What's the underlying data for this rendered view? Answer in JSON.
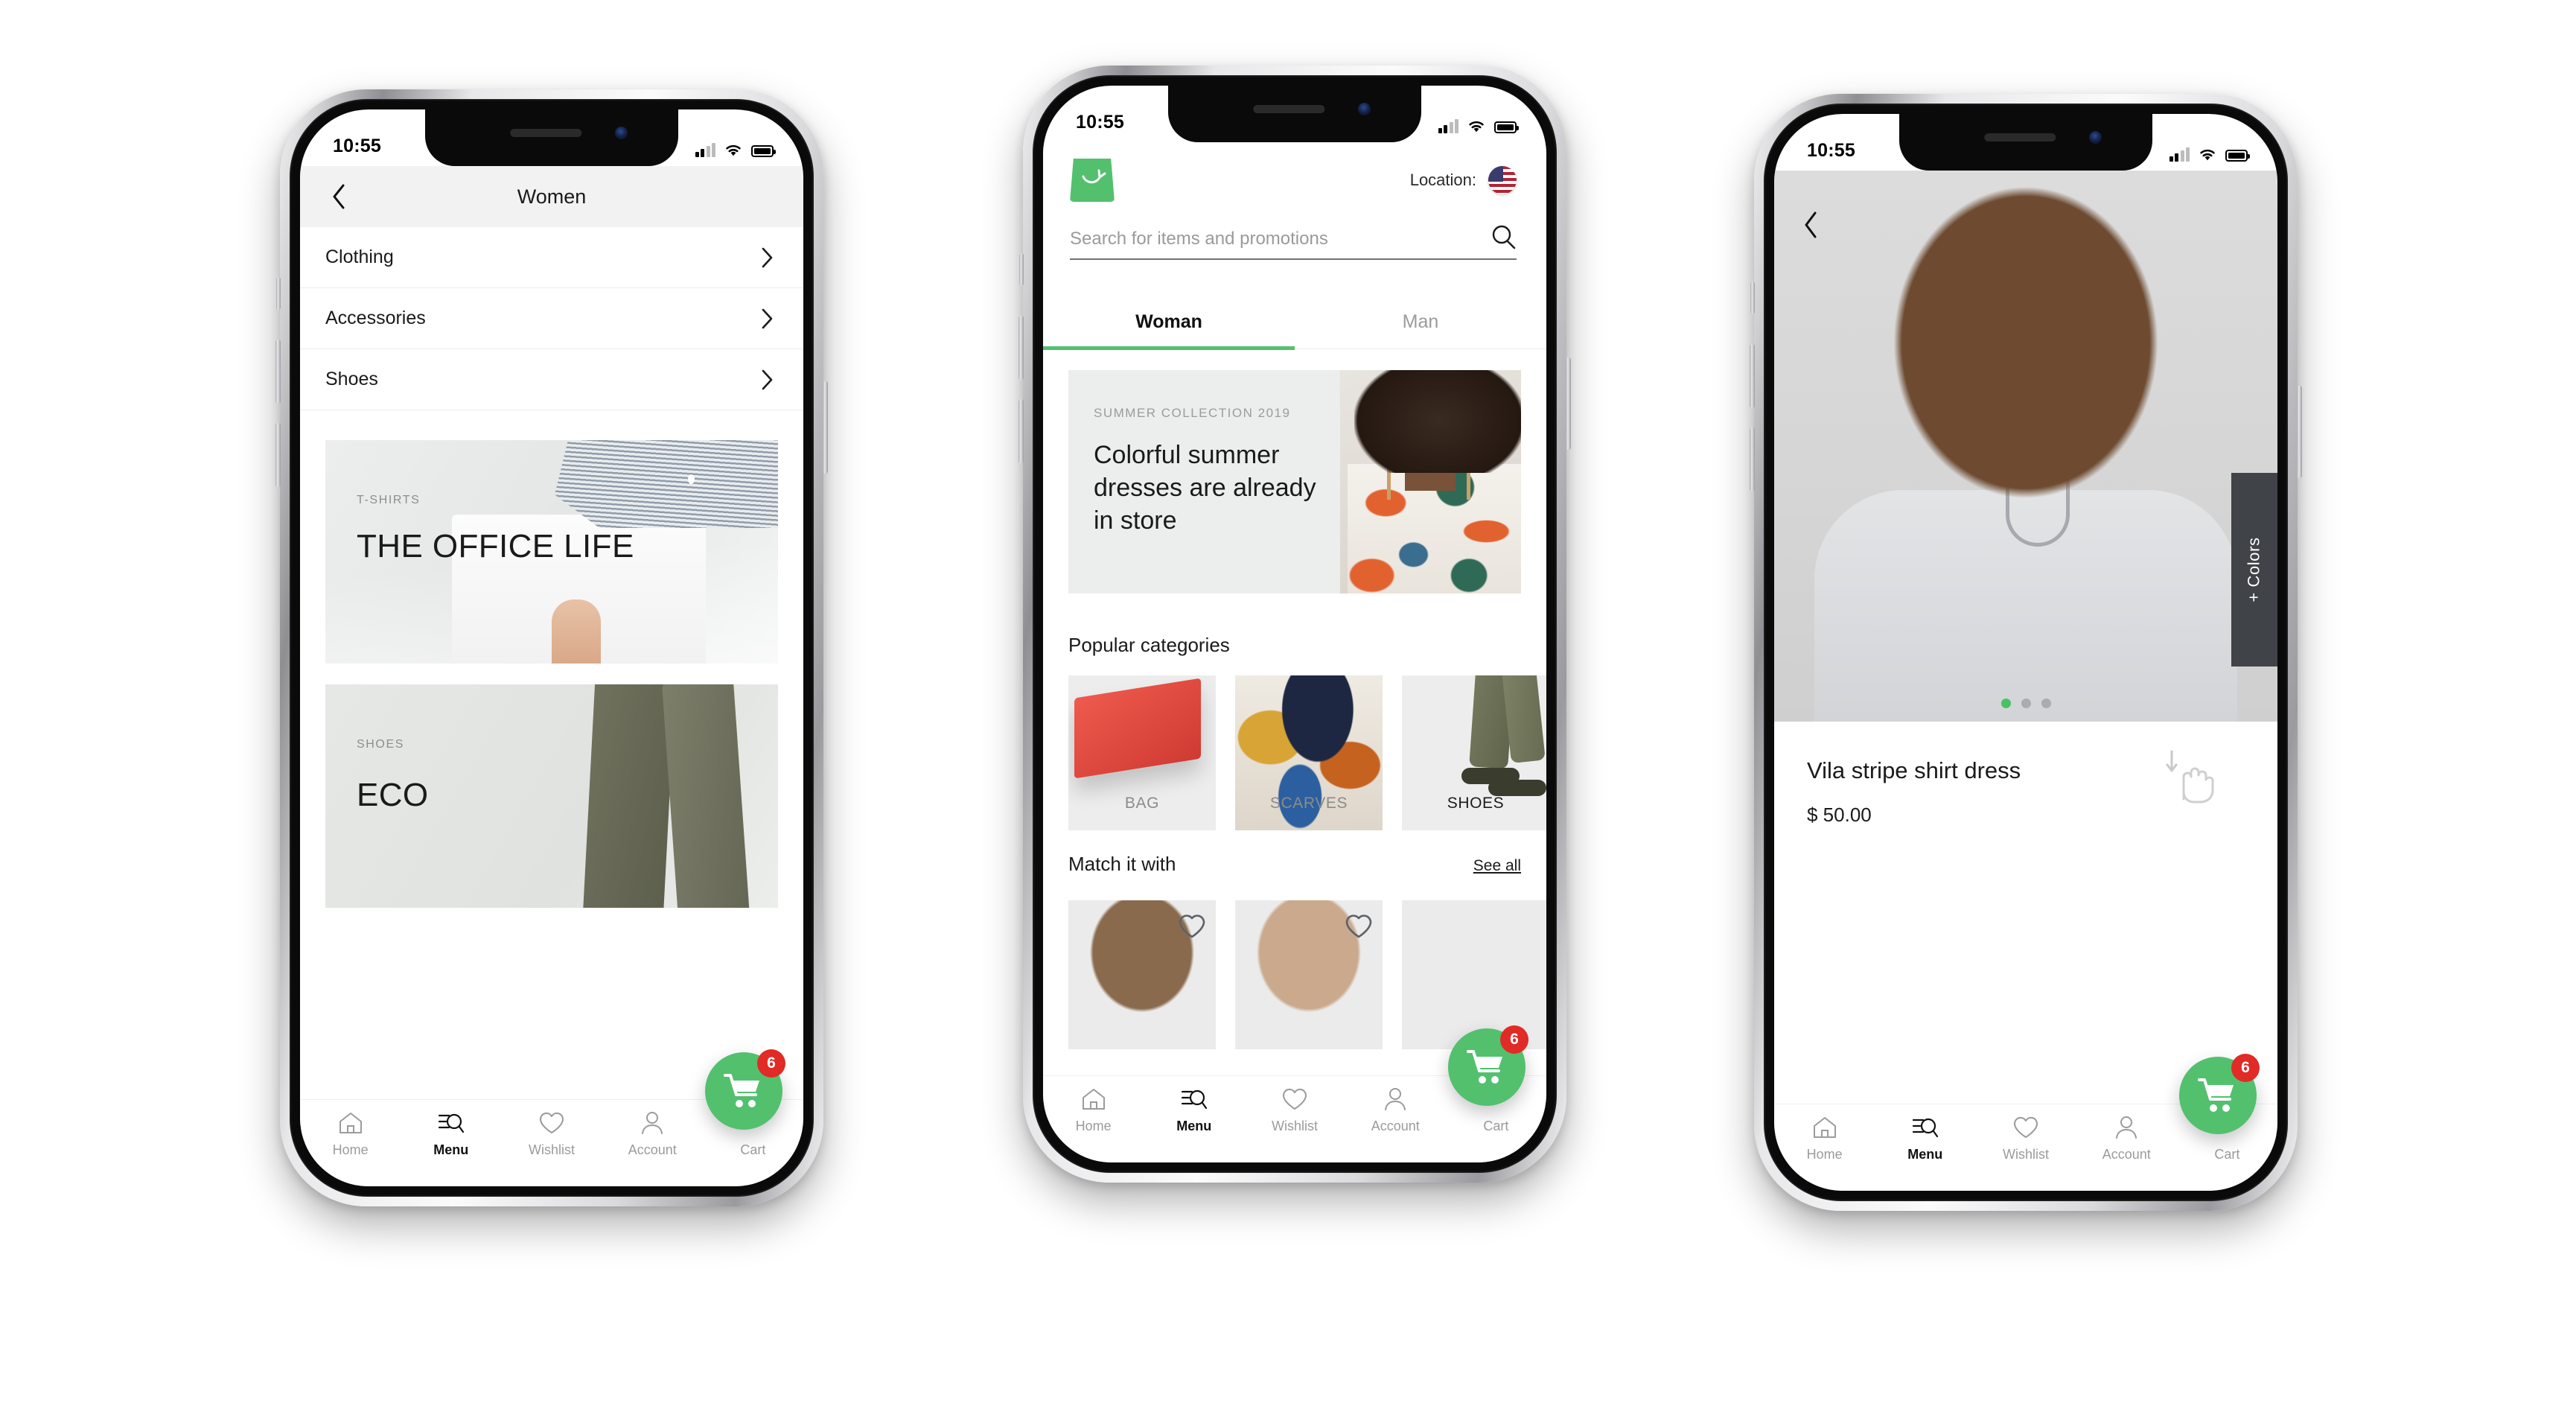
{
  "app": {
    "brand_green": "#53c06e",
    "badge_red": "#e02b26",
    "logo_icon": "shopping-bag-icon"
  },
  "status_bar": {
    "time": "10:55",
    "signal_icon": "cellular-signal-icon",
    "wifi_icon": "wifi-icon",
    "battery_icon": "battery-full-icon"
  },
  "tabbar": {
    "items": [
      {
        "label": "Home",
        "icon": "home-icon",
        "active": false
      },
      {
        "label": "Menu",
        "icon": "menu-search-icon",
        "active": true
      },
      {
        "label": "Wishlist",
        "icon": "heart-icon",
        "active": false
      },
      {
        "label": "Account",
        "icon": "person-icon",
        "active": false
      },
      {
        "label": "Cart",
        "icon": "cart-icon",
        "active": false
      }
    ]
  },
  "cart_fab": {
    "icon": "shopping-cart-icon",
    "badge_count": "6"
  },
  "phone1": {
    "header": {
      "title": "Women",
      "back_icon": "chevron-left-icon"
    },
    "list": [
      {
        "label": "Clothing",
        "chevron": "chevron-right-icon"
      },
      {
        "label": "Accessories",
        "chevron": "chevron-right-icon"
      },
      {
        "label": "Shoes",
        "chevron": "chevron-right-icon"
      }
    ],
    "promos": [
      {
        "kicker": "T-SHIRTS",
        "title": "THE OFFICE LIFE"
      },
      {
        "kicker": "SHOES",
        "title": "ECO"
      }
    ]
  },
  "phone2": {
    "location": {
      "label": "Location:",
      "flag_icon": "us-flag-icon"
    },
    "search": {
      "placeholder": "Search for items and promotions",
      "value": "",
      "icon": "search-icon"
    },
    "segments": [
      {
        "label": "Woman",
        "active": true
      },
      {
        "label": "Man",
        "active": false
      }
    ],
    "hero": {
      "kicker": "SUMMER COLLECTION 2019",
      "title": "Colorful summer dresses are already in store"
    },
    "popular": {
      "title": "Popular categories",
      "items": [
        {
          "label": "BAG",
          "active": false
        },
        {
          "label": "SCARVES",
          "active": false
        },
        {
          "label": "SHOES",
          "active": true
        },
        {
          "label": "",
          "active": false
        }
      ]
    },
    "match": {
      "title": "Match it with",
      "see_all": "See all",
      "cards": [
        {
          "wishlist_icon": "heart-outline-icon"
        },
        {
          "wishlist_icon": "heart-outline-icon"
        }
      ]
    }
  },
  "phone3": {
    "back_icon": "chevron-left-icon",
    "colors_tab": "+ Colors",
    "gallery_dots": {
      "total": 3,
      "active_index": 0
    },
    "product": {
      "name": "Vila stripe shirt dress",
      "price": "$ 50.00",
      "swipe_icon": "swipe-down-hand-icon"
    }
  }
}
